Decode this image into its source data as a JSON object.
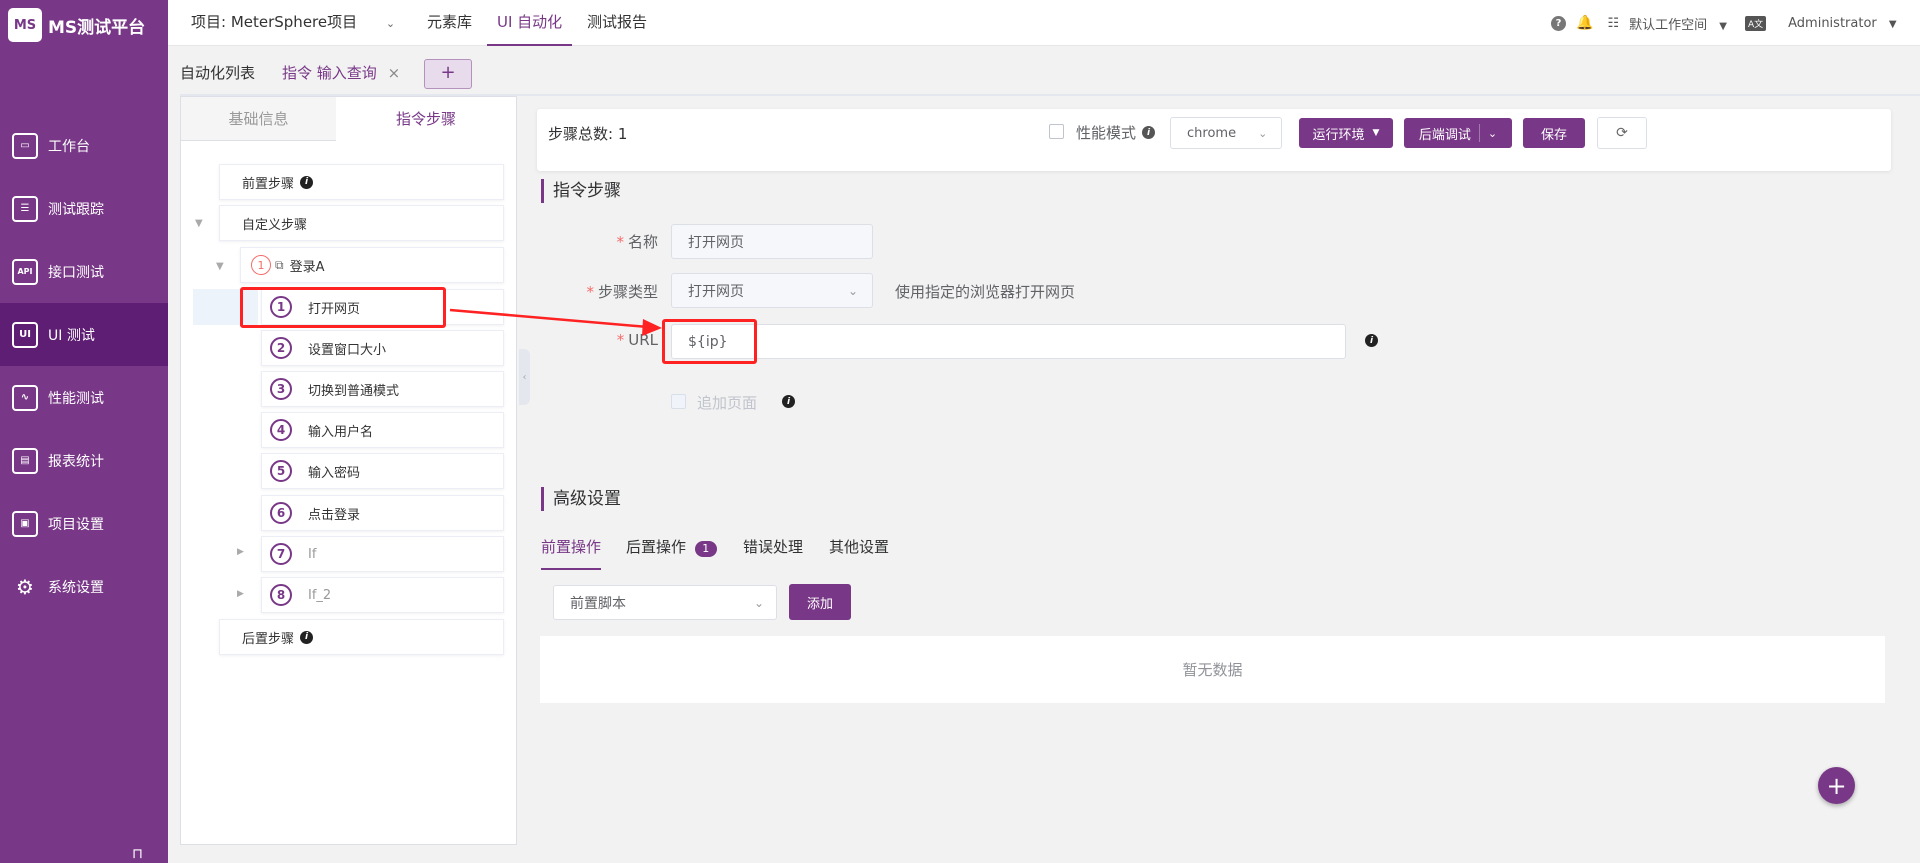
{
  "app": {
    "logo_text": "MS测试平台",
    "logo_mark": "MS"
  },
  "sidebar": {
    "items": [
      {
        "label": "工作台",
        "icon": "monitor-icon",
        "glyph": "▭"
      },
      {
        "label": "测试跟踪",
        "icon": "clipboard-icon",
        "glyph": "☰"
      },
      {
        "label": "接口测试",
        "icon": "api-icon",
        "glyph": "API"
      },
      {
        "label": "UI 测试",
        "icon": "ui-icon",
        "glyph": "UI"
      },
      {
        "label": "性能测试",
        "icon": "chart-icon",
        "glyph": "∿"
      },
      {
        "label": "报表统计",
        "icon": "report-icon",
        "glyph": "▤"
      },
      {
        "label": "项目设置",
        "icon": "folder-icon",
        "glyph": "▣"
      },
      {
        "label": "系统设置",
        "icon": "gear-icon",
        "glyph": "⚙"
      }
    ],
    "active_index": 3,
    "pin_glyph": "⊓"
  },
  "header": {
    "project": "项目: MeterSphere项目",
    "links": [
      "元素库",
      "UI 自动化",
      "测试报告"
    ],
    "active_link": "UI 自动化",
    "workspace": "默认工作空间",
    "user": "Administrator",
    "lang_icon": "A文"
  },
  "tabs": {
    "list_label": "自动化列表",
    "active_label": "指令 输入查询",
    "close_glyph": "×",
    "add_glyph": "+"
  },
  "left_panel": {
    "tabs": [
      "基础信息",
      "指令步骤"
    ],
    "active_tab": "指令步骤",
    "pre_steps": "前置步骤",
    "custom_steps": "自定义步骤",
    "group": {
      "index": "1",
      "label": "登录A"
    },
    "steps": [
      {
        "index": "1",
        "label": "打开网页"
      },
      {
        "index": "2",
        "label": "设置窗口大小"
      },
      {
        "index": "3",
        "label": "切换到普通模式"
      },
      {
        "index": "4",
        "label": "输入用户名"
      },
      {
        "index": "5",
        "label": "输入密码"
      },
      {
        "index": "6",
        "label": "点击登录"
      },
      {
        "index": "7",
        "label": "If"
      },
      {
        "index": "8",
        "label": "If_2"
      }
    ],
    "post_steps": "后置步骤"
  },
  "summary": {
    "step_count_label": "步骤总数: 1",
    "perf_mode": "性能模式",
    "browser": "chrome",
    "run_env": "运行环境",
    "backend_debug": "后端调试",
    "save": "保存",
    "refresh_glyph": "⟳"
  },
  "form": {
    "section_title": "指令步骤",
    "name_label": "名称",
    "name_value": "打开网页",
    "type_label": "步骤类型",
    "type_value": "打开网页",
    "type_hint": "使用指定的浏览器打开网页",
    "url_label": "URL",
    "url_value": "${ip}",
    "append_page": "追加页面"
  },
  "advanced": {
    "title": "高级设置",
    "tabs": [
      "前置操作",
      "后置操作",
      "错误处理",
      "其他设置"
    ],
    "post_badge": "1",
    "script_select": "前置脚本",
    "add_button": "添加",
    "empty_text": "暂无数据"
  },
  "colors": {
    "brand": "#783887",
    "annotation": "#ff2222"
  }
}
